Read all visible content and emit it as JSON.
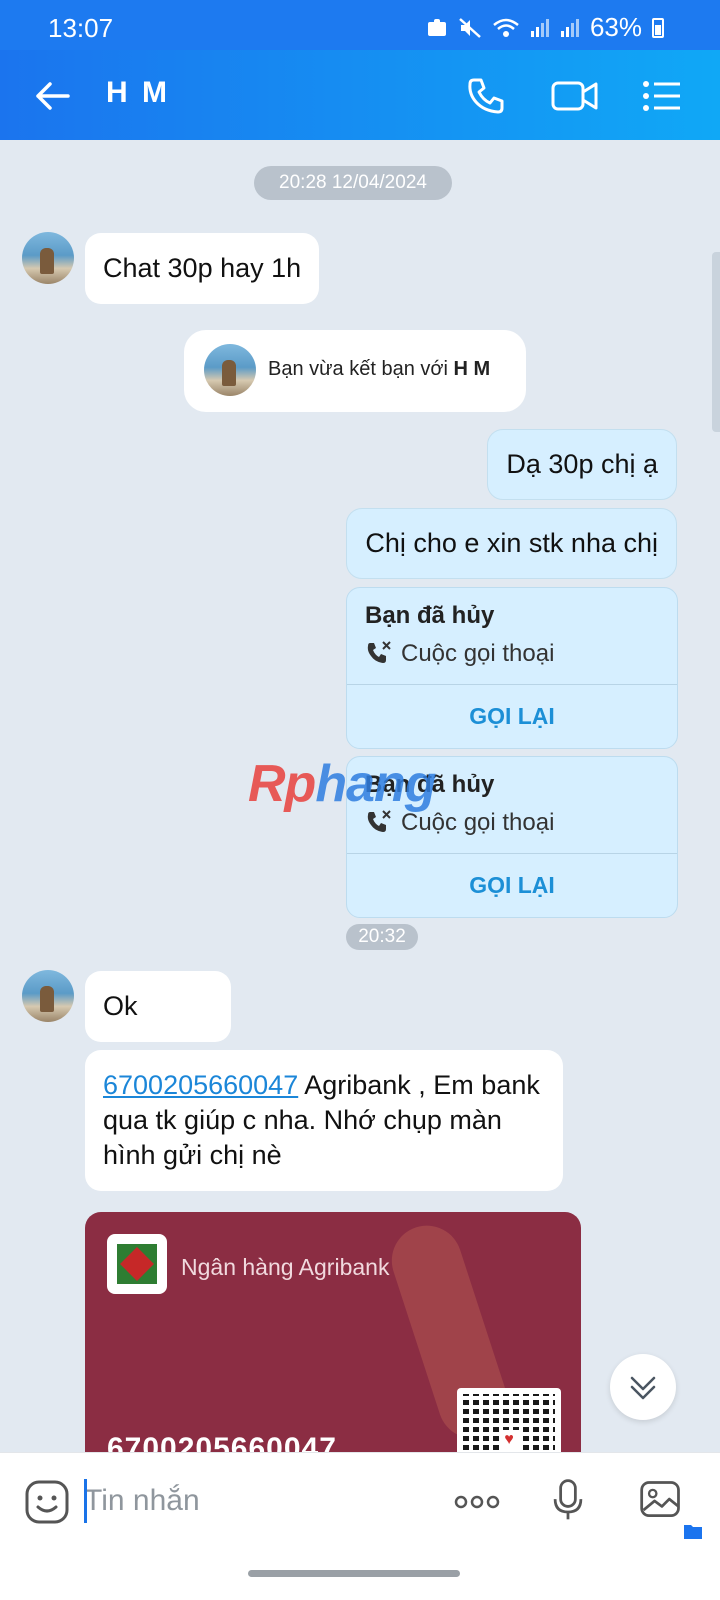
{
  "status": {
    "time": "13:07",
    "battery": "63%"
  },
  "header": {
    "contact_name": "H M"
  },
  "chat": {
    "timestamp_1": "20:28 12/04/2024",
    "msg_in_1": "Chat 30p hay 1h",
    "friend_notice_prefix": "Bạn vừa kết bạn với",
    "friend_notice_name": "H M",
    "msg_out_1": "Dạ 30p chị ạ",
    "msg_out_2": "Chị cho e xin stk nha chị",
    "call_1": {
      "title": "Bạn đã hủy",
      "subtitle": "Cuộc gọi thoại",
      "action": "GỌI LẠI"
    },
    "call_2": {
      "title": "Bạn đã hủy",
      "subtitle": "Cuộc gọi thoại",
      "action": "GỌI LẠI"
    },
    "timestamp_2": "20:32",
    "msg_in_2": "Ok",
    "msg_in_3_account": "6700205660047",
    "msg_in_3_text": " Agribank , Em bank qua tk giúp c nha. Nhớ chụp màn hình gửi chị nè",
    "bank_card": {
      "bank_name": "Ngân hàng Agribank",
      "account_number": "6700205660047"
    }
  },
  "watermark": {
    "part1": "Rp",
    "part2": "hang"
  },
  "composer": {
    "placeholder": "Tin nhắn"
  },
  "colors": {
    "header_start": "#1b74ee",
    "header_end": "#10a8f6",
    "out_bubble": "#d6efff",
    "card": "#8b2d43",
    "link": "#1b86d8"
  }
}
